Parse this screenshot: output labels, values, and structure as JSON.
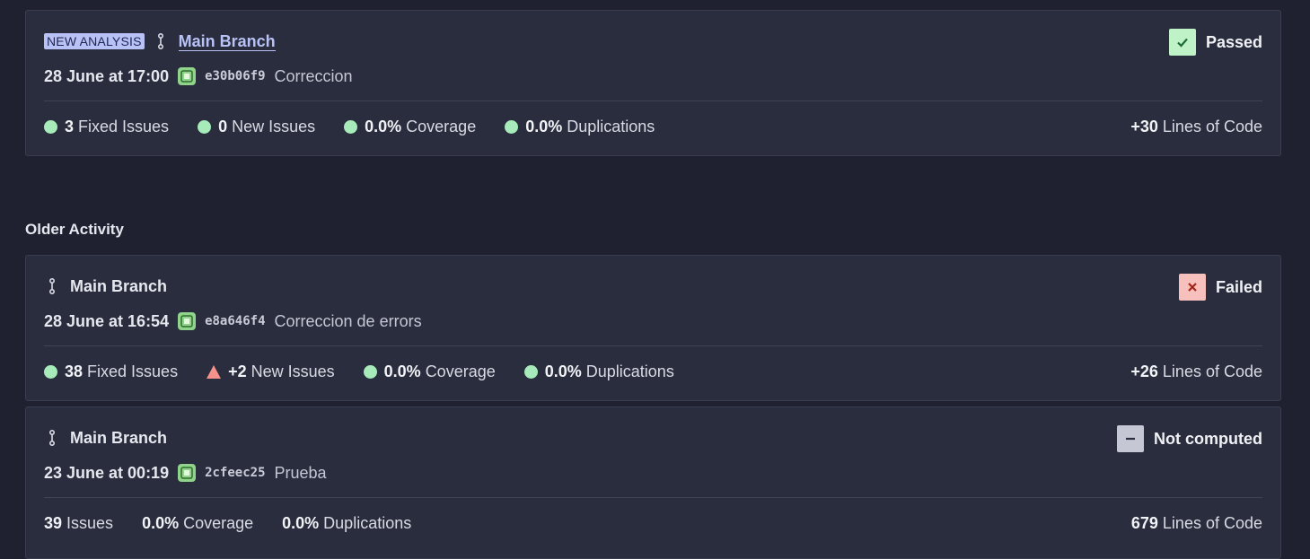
{
  "latest": {
    "badge": "NEW ANALYSIS",
    "branch": "Main Branch",
    "status": "Passed",
    "date": "28 June at 17:00",
    "hash": "e30b06f9",
    "message": "Correccion",
    "metrics": {
      "fixed_value": "3",
      "fixed_label": "Fixed Issues",
      "new_value": "0",
      "new_label": "New Issues",
      "coverage_value": "0.0%",
      "coverage_label": "Coverage",
      "dup_value": "0.0%",
      "dup_label": "Duplications",
      "loc_value": "+30",
      "loc_label": "Lines of Code"
    }
  },
  "older": {
    "title": "Older Activity",
    "items": [
      {
        "branch": "Main Branch",
        "status": "Failed",
        "date": "28 June at 16:54",
        "hash": "e8a646f4",
        "message": "Correccion de errors",
        "fixed_value": "38",
        "fixed_label": "Fixed Issues",
        "new_value": "+2",
        "new_label": "New Issues",
        "coverage_value": "0.0%",
        "coverage_label": "Coverage",
        "dup_value": "0.0%",
        "dup_label": "Duplications",
        "loc_value": "+26",
        "loc_label": "Lines of Code"
      },
      {
        "branch": "Main Branch",
        "status": "Not computed",
        "date": "23 June at 00:19",
        "hash": "2cfeec25",
        "message": "Prueba",
        "issues_value": "39",
        "issues_label": "Issues",
        "coverage_value": "0.0%",
        "coverage_label": "Coverage",
        "dup_value": "0.0%",
        "dup_label": "Duplications",
        "loc_value": "679",
        "loc_label": "Lines of Code"
      }
    ]
  },
  "colors": {
    "background": "#1f2130",
    "card": "#2a2d3d",
    "passed": "#bff2c6",
    "failed": "#f8c0bc",
    "not_computed": "#c5c8d4",
    "ok_dot": "#a6ebb9",
    "warn_triangle": "#f4928b",
    "accent": "#b9c2f7"
  },
  "icons": {
    "branch": "branch-icon",
    "commit": "commit-icon",
    "passed": "check-icon",
    "failed": "x-icon",
    "not_computed": "dash-icon"
  }
}
